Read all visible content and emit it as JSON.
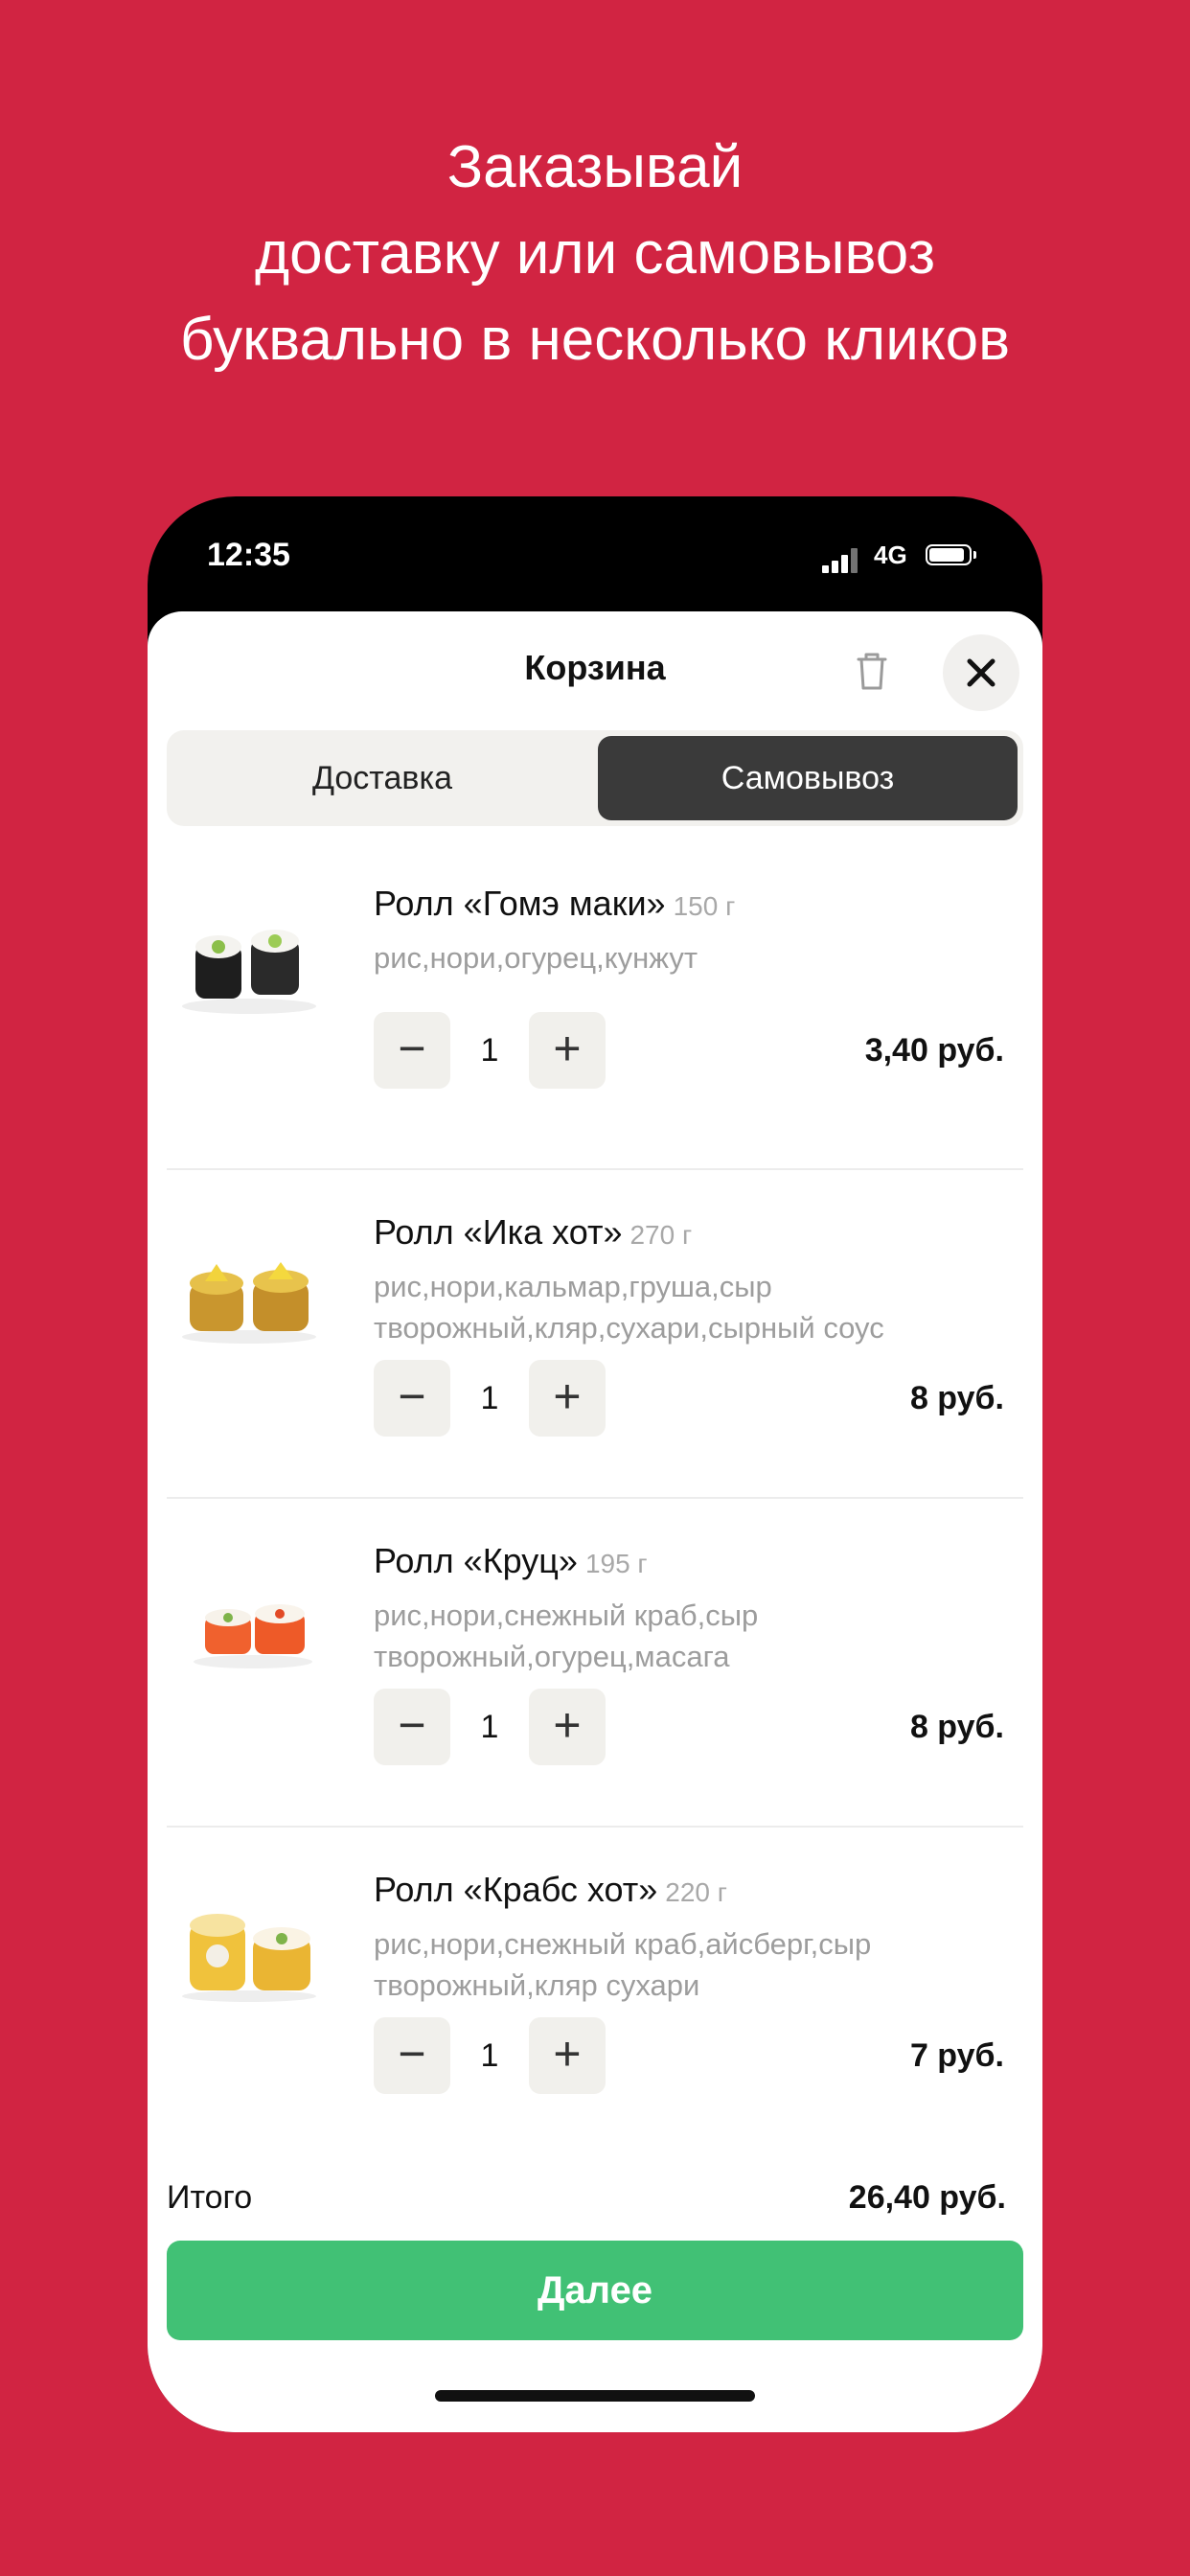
{
  "promo": {
    "line1": "Заказывай",
    "line2": "доставку или самовывоз",
    "line3": "буквально в несколько кликов"
  },
  "status_bar": {
    "time": "12:35",
    "network": "4G"
  },
  "header": {
    "title": "Корзина",
    "trash_icon": "trash-icon",
    "close_icon": "close-icon"
  },
  "delivery_toggle": {
    "options": [
      "Доставка",
      "Самовывоз"
    ],
    "selected": "Самовывоз"
  },
  "cart": {
    "items": [
      {
        "name": "Ролл «Гомэ маки»",
        "weight": "150 г",
        "ingredients": "рис,нори,огурец,кунжут",
        "qty": "1",
        "price": "3,40 руб."
      },
      {
        "name": "Ролл «Ика хот»",
        "weight": "270 г",
        "ingredients": "рис,нори,кальмар,груша,сыр творожный,кляр,сухари,сырный соус",
        "qty": "1",
        "price": "8 руб."
      },
      {
        "name": "Ролл «Круц»",
        "weight": "195 г",
        "ingredients": "рис,нори,снежный краб,сыр творожный,огурец,масага",
        "qty": "1",
        "price": "8 руб."
      },
      {
        "name": "Ролл «Крабс хот»",
        "weight": "220 г",
        "ingredients": "рис,нори,снежный краб,айсберг,сыр творожный,кляр сухари",
        "qty": "1",
        "price": "7 руб."
      }
    ]
  },
  "stepper": {
    "minus": "−",
    "plus": "+"
  },
  "footer": {
    "total_label": "Итого",
    "total_value": "26,40 руб.",
    "next_label": "Далее"
  },
  "colors": {
    "background": "#d12442",
    "accent_green": "#41c175",
    "segment_selected": "#3a3a3a"
  }
}
